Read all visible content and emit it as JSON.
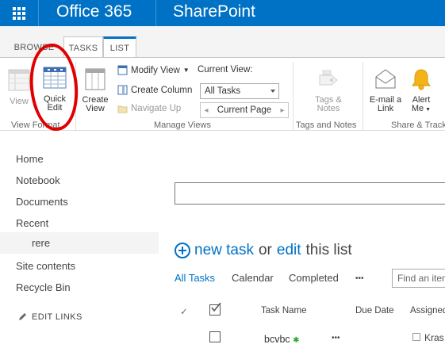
{
  "suite_bar": {
    "app_name": "Office 365",
    "site_name": "SharePoint",
    "color": "#0072c6"
  },
  "ribbon_tabs": [
    {
      "label": "BROWSE",
      "active": false
    },
    {
      "label": "TASKS",
      "active": true
    },
    {
      "label": "LIST",
      "active": true
    }
  ],
  "ribbon": {
    "view_format": {
      "view_label": "View",
      "quick_edit_label": [
        "Quick",
        "Edit"
      ],
      "group_label": "View Format"
    },
    "manage_views": {
      "create_view_label": [
        "Create",
        "View"
      ],
      "modify_view_label": "Modify View",
      "create_column_label": "Create Column",
      "navigate_up_label": "Navigate Up",
      "current_view_label": "Current View:",
      "current_view_value": "All Tasks",
      "current_page_label": "Current Page",
      "group_label": "Manage Views"
    },
    "tags_notes": {
      "button_label": [
        "Tags &",
        "Notes"
      ],
      "group_label": "Tags and Notes"
    },
    "share_track": {
      "email_link_label": [
        "E-mail a",
        "Link"
      ],
      "alert_me_label": [
        "Alert",
        "Me"
      ],
      "group_label": "Share & Track"
    }
  },
  "annotation_color": "#e00000",
  "left_nav": {
    "items": [
      "Home",
      "Notebook",
      "Documents",
      "Recent"
    ],
    "sub_item": "rere",
    "bottom_items": [
      "Site contents",
      "Recycle Bin"
    ],
    "edit_links": "EDIT LINKS"
  },
  "main": {
    "new_task_prefix": "new task",
    "new_task_middle": "or",
    "edit_link": "edit",
    "new_task_suffix": "this list",
    "views": [
      "All Tasks",
      "Calendar",
      "Completed"
    ],
    "more_ellipsis": "•••",
    "find_placeholder": "Find an item",
    "columns": {
      "check": "✓",
      "task_name": "Task Name",
      "due_date": "Due Date",
      "assigned": "Assigned"
    },
    "rows": [
      {
        "task_name": "bcvbc",
        "assigned": "Kras",
        "menu": "•••"
      }
    ]
  }
}
